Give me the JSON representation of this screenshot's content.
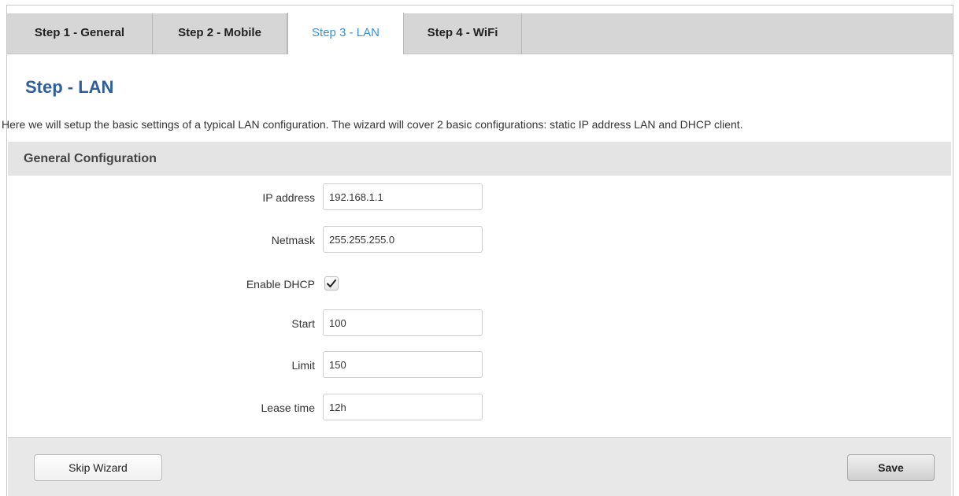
{
  "tabs": [
    {
      "label": "Step 1 - General"
    },
    {
      "label": "Step 2 - Mobile"
    },
    {
      "label": "Step 3 - LAN",
      "active": true
    },
    {
      "label": "Step 4 - WiFi"
    }
  ],
  "page": {
    "title": "Step - LAN",
    "description": "Here we will setup the basic settings of a typical LAN configuration. The wizard will cover 2 basic configurations: static IP address LAN and DHCP client."
  },
  "section": {
    "title": "General Configuration"
  },
  "fields": {
    "ip_address": {
      "label": "IP address",
      "value": "192.168.1.1"
    },
    "netmask": {
      "label": "Netmask",
      "value": "255.255.255.0"
    },
    "enable_dhcp": {
      "label": "Enable DHCP",
      "checked": true
    },
    "start": {
      "label": "Start",
      "value": "100"
    },
    "limit": {
      "label": "Limit",
      "value": "150"
    },
    "lease_time": {
      "label": "Lease time",
      "value": "12h"
    }
  },
  "footer": {
    "skip_label": "Skip Wizard",
    "save_label": "Save"
  },
  "colors": {
    "active_tab_text": "#3a8fd6",
    "title": "#2e5e9e",
    "tabbar_bg": "#d6d6d6",
    "section_bg": "#e4e4e4"
  }
}
